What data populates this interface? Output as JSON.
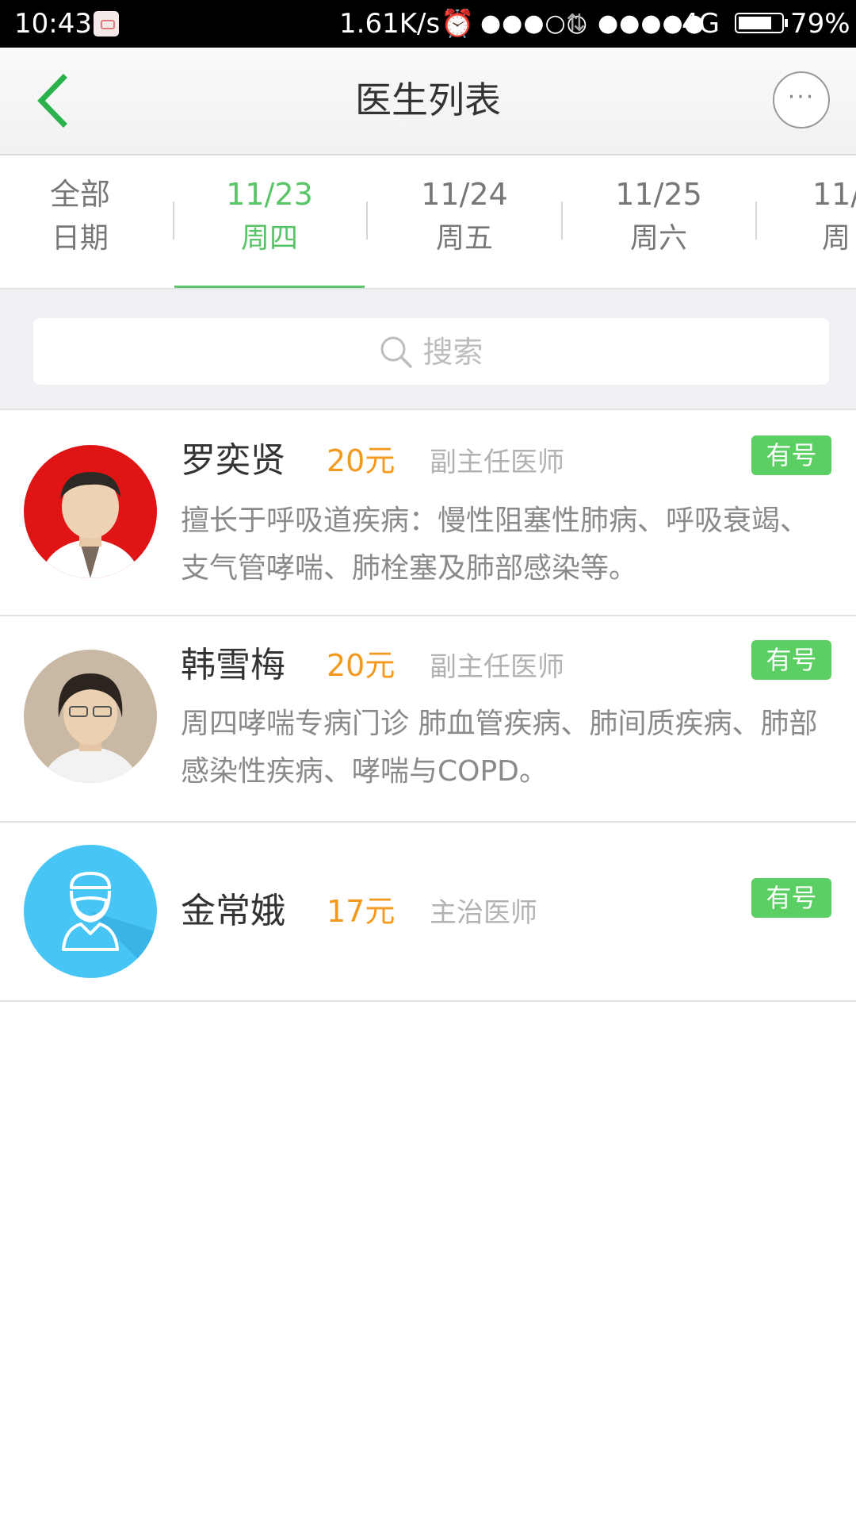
{
  "status_bar": {
    "time": "10:43",
    "network_speed": "1.61K/s",
    "signal1": "●●●○○",
    "signal2": "●●●●●",
    "network_type": "4G",
    "battery": "79%",
    "battery_level": 0.79
  },
  "nav": {
    "title": "医生列表",
    "back_icon": "chevron-left-icon",
    "more_icon": "more-icon",
    "accent_color": "#2bb24c"
  },
  "date_tabs": [
    {
      "line1": "全部",
      "line2": "日期",
      "active": false
    },
    {
      "line1": "11/23",
      "line2": "周四",
      "active": true
    },
    {
      "line1": "11/24",
      "line2": "周五",
      "active": false
    },
    {
      "line1": "11/25",
      "line2": "周六",
      "active": false
    },
    {
      "line1": "11/",
      "line2": "周",
      "active": false
    }
  ],
  "search": {
    "placeholder": "搜索"
  },
  "doctors": [
    {
      "name": "罗奕贤",
      "price": "20元",
      "title": "副主任医师",
      "badge": "有号",
      "description": "擅长于呼吸道疾病：慢性阻塞性肺病、呼吸衰竭、支气管哮喘、肺栓塞及肺部感染等。"
    },
    {
      "name": "韩雪梅",
      "price": "20元",
      "title": "副主任医师",
      "badge": "有号",
      "description": "周四哮喘专病门诊 肺血管疾病、肺间质疾病、肺部感染性疾病、哮喘与COPD。"
    },
    {
      "name": "金常娥",
      "price": "17元",
      "title": "主治医师",
      "badge": "有号",
      "description": ""
    }
  ]
}
